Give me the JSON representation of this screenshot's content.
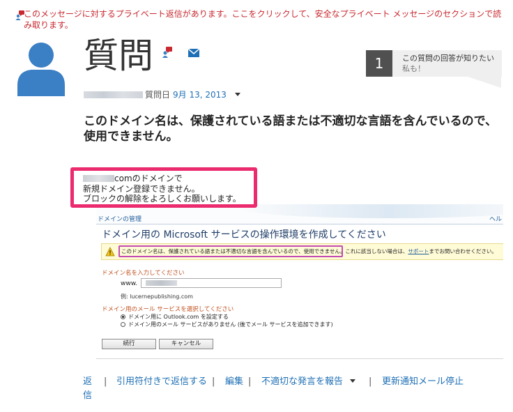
{
  "private_banner": {
    "text": "このメッセージに対するプライベート返信があります。ここをクリックして、安全なプライベート メッセージのセクションで読み取ります。",
    "icon": "private-message-icon",
    "color": "#c8282f"
  },
  "header": {
    "title": "質問",
    "icons": [
      "private-message-icon",
      "mail-icon"
    ]
  },
  "metoo": {
    "count": "1",
    "line1": "この質問の回答が知りたい",
    "line2": "私も！"
  },
  "meta": {
    "asked_label": "質問日",
    "date": "9月 13, 2013"
  },
  "question": {
    "title": "このドメイン名は、保護されている語または不適切な言語を含んでいるので、使用できません。"
  },
  "body": {
    "line1_suffix": "comのドメインで",
    "line2": "新規ドメイン登録できません。",
    "line3": "ブロックの解除をよろしくお願いします。"
  },
  "screenshot": {
    "breadcrumb": "ドメインの管理",
    "help": "ヘル",
    "heading": "ドメイン用の Microsoft サービスの操作環境を作成してください",
    "warning_main": "このドメイン名は、保護されている語または不適切な言語を含んでいるので、使用できません。",
    "warning_tail": "これに該当しない場合は、",
    "warning_link": "サポート",
    "warning_end": "までお問い合わせください。",
    "domain_label": "ドメイン名を入力してください",
    "www": "www.",
    "example": "例: lucernepublishing.com",
    "mail_label": "ドメイン用のメール サービスを選択してください",
    "option1": "ドメイン用に Outlook.com を設定する",
    "option2": "ドメイン用のメール サービスがありません (後でメール サービスを追加できます)",
    "continue": "続行",
    "cancel": "キャンセル"
  },
  "actions": {
    "reply": "返信",
    "quote_reply": "引用符付きで返信する",
    "edit": "編集",
    "report": "不適切な発言を報告",
    "stop_alerts": "更新通知メール停止",
    "separator": "|"
  },
  "colors": {
    "link": "#1e6fb5",
    "highlight_pink": "#ec2a6e",
    "highlight_purple": "#c34bb4",
    "avatar": "#3b7fc4"
  }
}
